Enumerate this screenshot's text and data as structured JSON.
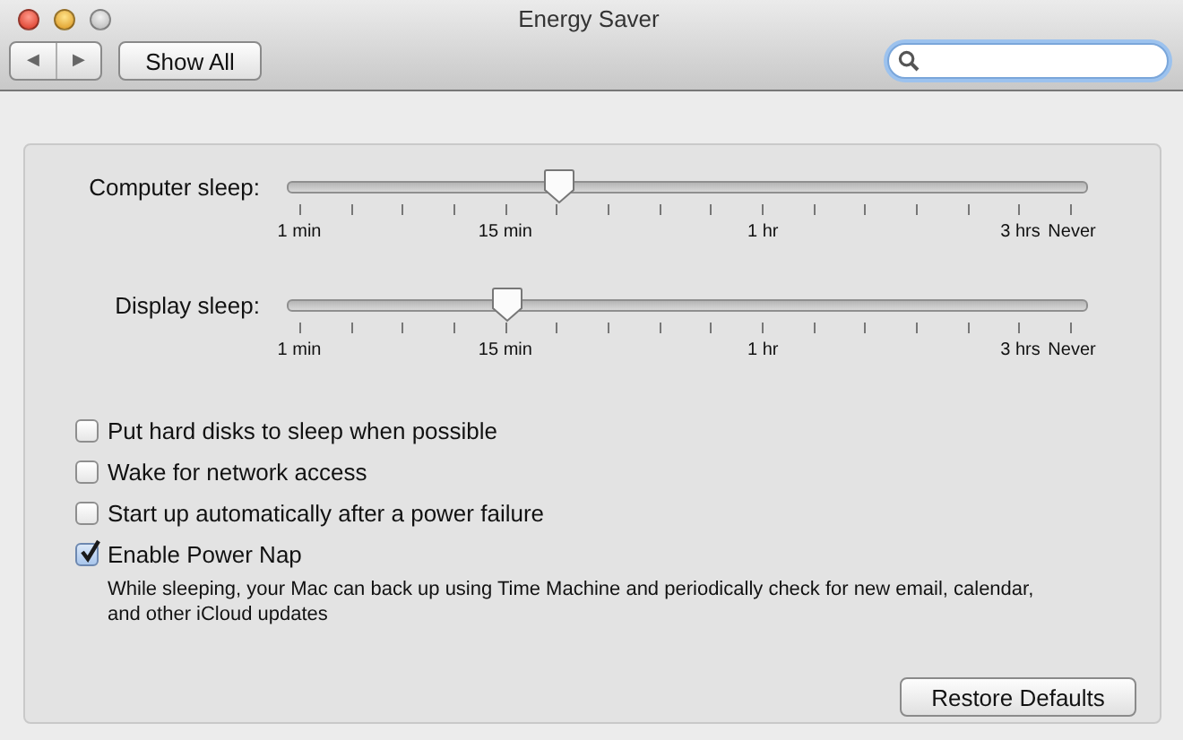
{
  "window": {
    "title": "Energy Saver"
  },
  "toolbar": {
    "back_label": "◀",
    "forward_label": "▶",
    "show_all": "Show All"
  },
  "sliders": [
    {
      "label": "Computer sleep:",
      "level": 0.339,
      "tick_labels": [
        "1 min",
        "15 min",
        "1 hr",
        "3 hrs",
        "Never"
      ]
    },
    {
      "label": "Display sleep:",
      "level": 0.276,
      "tick_labels": [
        "1 min",
        "15 min",
        "1 hr",
        "3 hrs",
        "Never"
      ]
    }
  ],
  "options": [
    {
      "label": "Put hard disks to sleep when possible",
      "checked": false
    },
    {
      "label": "Wake for network access",
      "checked": false
    },
    {
      "label": "Start up automatically after a power failure",
      "checked": false
    },
    {
      "label": "Enable Power Nap",
      "checked": true,
      "description": "While sleeping, your Mac can back up using Time Machine and periodically check for new email, calendar, and other iCloud updates"
    }
  ],
  "buttons": [
    "Restore Defaults"
  ]
}
